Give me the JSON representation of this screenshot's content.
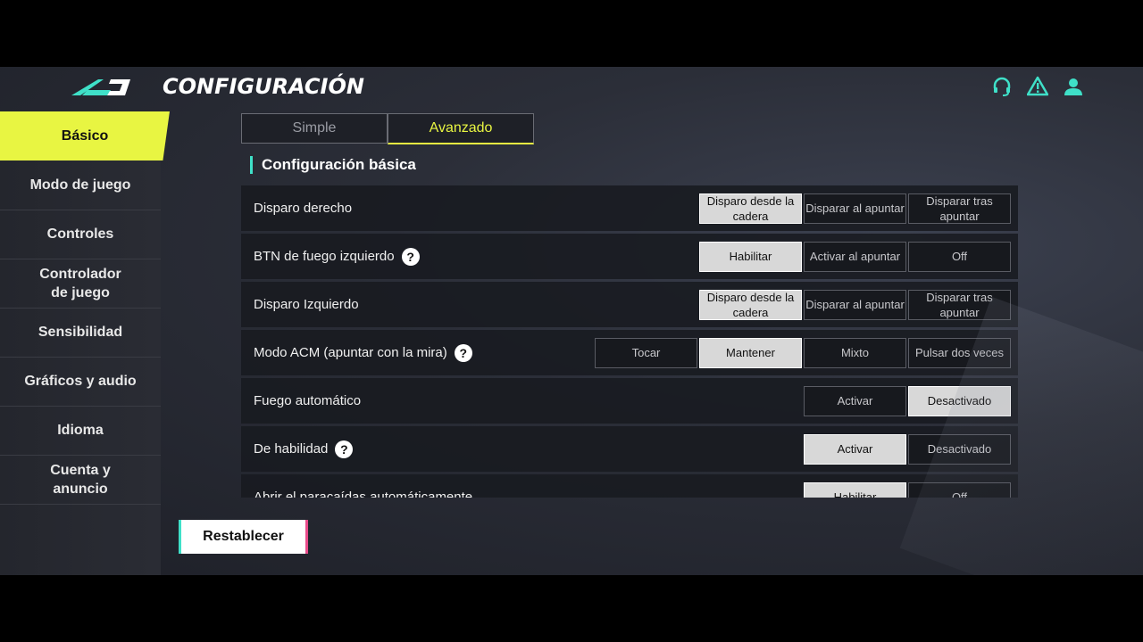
{
  "header": {
    "title": "CONFIGURACIÓN",
    "icons": [
      "headset-icon",
      "warning-icon",
      "user-icon"
    ],
    "accent": "#3fe0c8"
  },
  "sidebar": {
    "items": [
      {
        "label": "Básico",
        "active": true
      },
      {
        "label": "Modo de juego"
      },
      {
        "label": "Controles"
      },
      {
        "label": "Controlador de juego"
      },
      {
        "label": "Sensibilidad"
      },
      {
        "label": "Gráficos y audio"
      },
      {
        "label": "Idioma"
      },
      {
        "label": "Cuenta y anuncio"
      }
    ],
    "active_color": "#e8f542"
  },
  "mode_tabs": [
    {
      "label": "Simple",
      "active": false
    },
    {
      "label": "Avanzado",
      "active": true
    }
  ],
  "section": {
    "title": "Configuración básica"
  },
  "settings": [
    {
      "label": "Disparo derecho",
      "help": false,
      "options": [
        "Disparo desde la cadera",
        "Disparar al apuntar",
        "Disparar tras apuntar"
      ],
      "selected": 0
    },
    {
      "label": "BTN de fuego izquierdo",
      "help": true,
      "options": [
        "Habilitar",
        "Activar al apuntar",
        "Off"
      ],
      "selected": 0
    },
    {
      "label": "Disparo Izquierdo",
      "help": false,
      "options": [
        "Disparo desde la cadera",
        "Disparar al apuntar",
        "Disparar tras apuntar"
      ],
      "selected": 0
    },
    {
      "label": "Modo ACM (apuntar con la mira)",
      "help": true,
      "options": [
        "Tocar",
        "Mantener",
        "Mixto",
        "Pulsar dos veces"
      ],
      "selected": 1
    },
    {
      "label": "Fuego automático",
      "help": false,
      "options": [
        "Activar",
        "Desactivado"
      ],
      "selected": 1
    },
    {
      "label": "De habilidad",
      "help": true,
      "options": [
        "Activar",
        "Desactivado"
      ],
      "selected": 0
    },
    {
      "label": "Abrir el paracaídas automáticamente",
      "help": false,
      "options": [
        "Habilitar",
        "Off"
      ],
      "selected": 0
    }
  ],
  "reset_label": "Restablecer"
}
